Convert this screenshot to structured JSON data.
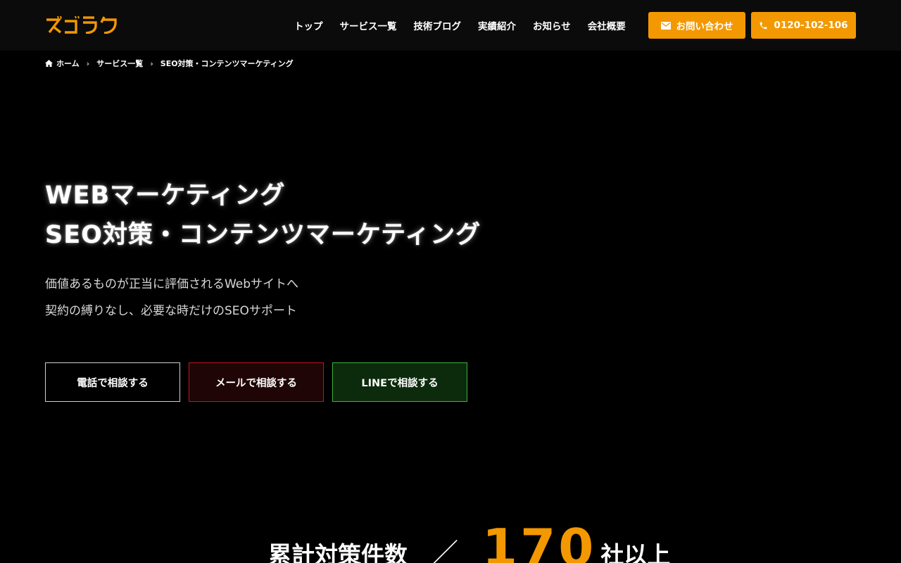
{
  "brand": {
    "logo_text": "ズゴラク",
    "accent_color": "#f39800"
  },
  "nav": {
    "items": [
      "トップ",
      "サービス一覧",
      "技術ブログ",
      "実績紹介",
      "お知らせ",
      "会社概要"
    ],
    "contact_label": "お問い合わせ",
    "phone_label": "0120-102-106"
  },
  "breadcrumb": {
    "home": "ホーム",
    "services": "サービス一覧",
    "current": "SEO対策・コンテンツマーケティング"
  },
  "hero": {
    "title_line1": "WEBマーケティング",
    "title_line2": "SEO対策・コンテンツマーケティング",
    "sub_line1": "価値あるものが正当に評価されるWebサイトへ",
    "sub_line2": "契約の縛りなし、必要な時だけのSEOサポート"
  },
  "cta": {
    "phone": "電話で相談する",
    "mail": "メールで相談する",
    "line": "LINEで相談する"
  },
  "stats": {
    "label": "累計対策件数",
    "slash": "／",
    "number": "170",
    "unit": "社以上"
  }
}
